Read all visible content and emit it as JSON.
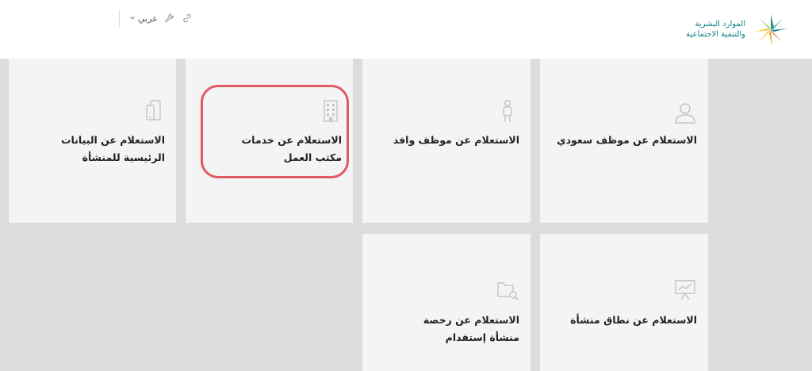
{
  "header": {
    "logo_line1": "الموارد البشرية",
    "logo_line2": "والتنمية الاجتماعية",
    "language_label": "عربي"
  },
  "cards": [
    {
      "title": "الاستعلام عن موظف سعودي",
      "icon": "user-icon"
    },
    {
      "title": "الاستعلام عن موظف وافد",
      "icon": "person-icon"
    },
    {
      "title": "الاستعلام عن خدمات مكتب العمل",
      "icon": "building-icon",
      "highlighted": true
    },
    {
      "title": "الاستعلام عن البيانات الرئيسية للمنشأة",
      "icon": "mobile-icon"
    },
    {
      "title": "الاستعلام عن نطاق منشأة",
      "icon": "presentation-chart-icon"
    },
    {
      "title": "الاستعلام عن رخصة منشأة إستقدام",
      "icon": "folder-search-icon"
    }
  ],
  "colors": {
    "brand_teal": "#0f7f86",
    "highlight": "#e05a66",
    "card_bg": "#f4f4f4",
    "page_bg": "#dcdcdc"
  }
}
